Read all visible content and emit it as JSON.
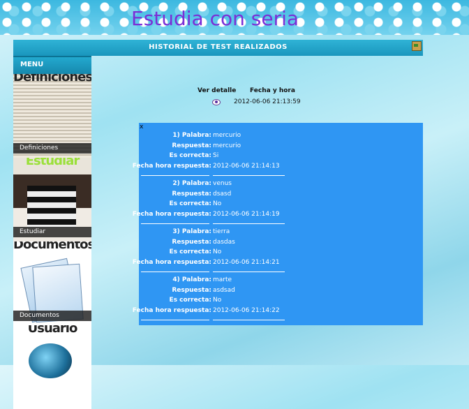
{
  "banner": {
    "title": "Estudia con seria"
  },
  "topbar": {
    "title": "HISTORIAL DE TEST REALIZADOS",
    "exit_icon": "exit-door-icon"
  },
  "menu": {
    "header": "MENU",
    "items": [
      {
        "title_art": "Definiciones",
        "label": "Definiciones"
      },
      {
        "title_art": "Estudiar",
        "label": "Estudiar"
      },
      {
        "title_art": "Documentos",
        "label": "Documentos"
      },
      {
        "title_art": "Usuario",
        "label": ""
      }
    ]
  },
  "history": {
    "col_detail": "Ver detalle",
    "col_datetime": "Fecha y hora",
    "rows": [
      {
        "detail_icon": "eye-icon",
        "datetime": "2012-06-06 21:13:59"
      }
    ]
  },
  "detail": {
    "close": "x",
    "entries": [
      {
        "palabra_label": "1) Palabra:",
        "palabra": "mercurio",
        "respuesta_label": "Respuesta:",
        "respuesta": "mercurio",
        "correcta_label": "Es correcta:",
        "correcta": "Si",
        "fecha_label": "Fecha hora respuesta:",
        "fecha": "2012-06-06 21:14:13"
      },
      {
        "palabra_label": "2) Palabra:",
        "palabra": "venus",
        "respuesta_label": "Respuesta:",
        "respuesta": "dsasd",
        "correcta_label": "Es correcta:",
        "correcta": "No",
        "fecha_label": "Fecha hora respuesta:",
        "fecha": "2012-06-06 21:14:19"
      },
      {
        "palabra_label": "3) Palabra:",
        "palabra": "tierra",
        "respuesta_label": "Respuesta:",
        "respuesta": "dasdas",
        "correcta_label": "Es correcta:",
        "correcta": "No",
        "fecha_label": "Fecha hora respuesta:",
        "fecha": "2012-06-06 21:14:21"
      },
      {
        "palabra_label": "4) Palabra:",
        "palabra": "marte",
        "respuesta_label": "Respuesta:",
        "respuesta": "asdsad",
        "correcta_label": "Es correcta:",
        "correcta": "No",
        "fecha_label": "Fecha hora respuesta:",
        "fecha": "2012-06-06 21:14:22"
      }
    ]
  },
  "colors": {
    "panel": "#2f96f3",
    "menu_bar": "#1a96bd",
    "title": "#7b2fd6"
  }
}
